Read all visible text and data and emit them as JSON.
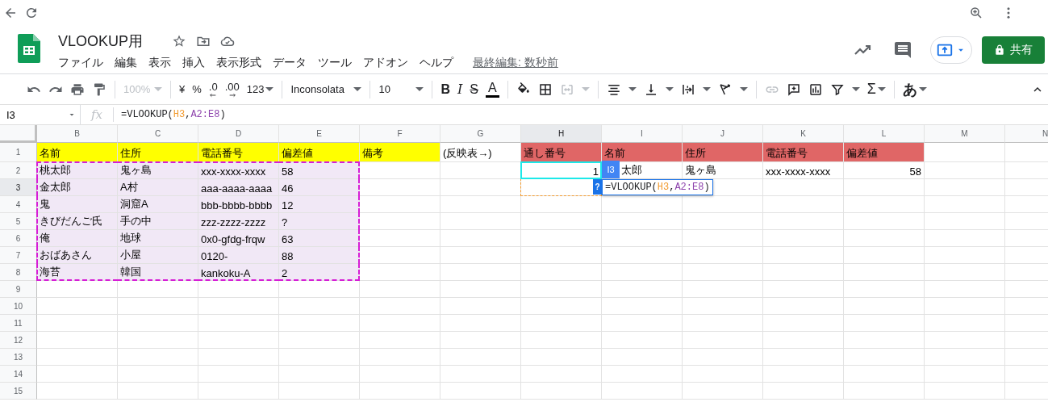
{
  "document": {
    "title": "VLOOKUP用",
    "menus": [
      "ファイル",
      "編集",
      "表示",
      "挿入",
      "表示形式",
      "データ",
      "ツール",
      "アドオン",
      "ヘルプ"
    ],
    "last_edit": "最終編集: 数秒前"
  },
  "share_button": {
    "label": "共有"
  },
  "toolbar": {
    "zoom": {
      "label": "100%",
      "disabled": true
    },
    "currency": "¥",
    "percent": "%",
    "decrease_decimals": ".0",
    "increase_decimals": ".00",
    "number_format": "123",
    "font": "Inconsolata",
    "font_size": "10",
    "bold": "B",
    "italic": "I",
    "strikethrough": "S",
    "text_color": "A",
    "functions": "Σ",
    "input_tools": "あ"
  },
  "formula_bar": {
    "name_box": "I3",
    "fx": "fx",
    "formula": [
      {
        "text": "=VLOOKUP("
      },
      {
        "text": "H3",
        "color": "#f29a2e"
      },
      {
        "text": ","
      },
      {
        "text": "A2:E8",
        "color": "#8e44ad"
      },
      {
        "text": ")"
      }
    ]
  },
  "grid": {
    "columns": [
      {
        "label": "B",
        "selected": false
      },
      {
        "label": "C",
        "selected": false
      },
      {
        "label": "D",
        "selected": false
      },
      {
        "label": "E",
        "selected": false
      },
      {
        "label": "F",
        "selected": false
      },
      {
        "label": "G",
        "selected": false
      },
      {
        "label": "H",
        "selected": true
      },
      {
        "label": "I",
        "selected": false
      },
      {
        "label": "J",
        "selected": false
      },
      {
        "label": "K",
        "selected": false
      },
      {
        "label": "L",
        "selected": false
      },
      {
        "label": "M",
        "selected": false
      },
      {
        "label": "N",
        "selected": false
      }
    ],
    "rows": [
      {
        "label": "1",
        "selected": false,
        "cells": [
          {
            "text": "名前",
            "kind": "text",
            "color": "#ffff00",
            "highlighted": false,
            "selected": false,
            "referenced": false
          },
          {
            "text": "住所",
            "kind": "text",
            "color": "#ffff00",
            "highlighted": false,
            "selected": false,
            "referenced": false
          },
          {
            "text": "電話番号",
            "kind": "text",
            "color": "#ffff00",
            "highlighted": false,
            "selected": false,
            "referenced": false
          },
          {
            "text": "偏差値",
            "kind": "text",
            "color": "#ffff00",
            "highlighted": false,
            "selected": false,
            "referenced": false
          },
          {
            "text": "備考",
            "kind": "text",
            "color": "#ffff00",
            "highlighted": false,
            "selected": false,
            "referenced": false
          },
          {
            "text": "(反映表→)",
            "kind": "text",
            "highlighted": false,
            "selected": false,
            "referenced": false
          },
          {
            "text": "通し番号",
            "kind": "text",
            "color": "#e06666",
            "highlighted": false,
            "selected": false,
            "referenced": false
          },
          {
            "text": "名前",
            "kind": "text",
            "color": "#e06666",
            "highlighted": false,
            "selected": false,
            "referenced": false
          },
          {
            "text": "住所",
            "kind": "text",
            "color": "#e06666",
            "highlighted": false,
            "selected": false,
            "referenced": false
          },
          {
            "text": "電話番号",
            "kind": "text",
            "color": "#e06666",
            "highlighted": false,
            "selected": false,
            "referenced": false
          },
          {
            "text": "偏差値",
            "kind": "text",
            "color": "#e06666",
            "highlighted": false,
            "selected": false,
            "referenced": false
          }
        ]
      },
      {
        "label": "2",
        "selected": false,
        "cells": [
          {
            "text": "桃太郎",
            "kind": "text",
            "highlighted": true,
            "selected": false,
            "referenced": false
          },
          {
            "text": "鬼ヶ島",
            "kind": "text",
            "highlighted": true,
            "selected": false,
            "referenced": false
          },
          {
            "text": "xxx-xxxx-xxxx",
            "kind": "text",
            "highlighted": true,
            "selected": false,
            "referenced": false
          },
          {
            "text": "58",
            "kind": "text",
            "highlighted": true,
            "selected": false,
            "referenced": false
          },
          null,
          null,
          {
            "text": "1",
            "kind": "number",
            "highlighted": false,
            "selected": true,
            "referenced": false
          },
          {
            "text": "太郎",
            "kind": "covered",
            "highlighted": false,
            "selected": false,
            "referenced": false
          },
          {
            "text": "鬼ヶ島",
            "kind": "text",
            "highlighted": false,
            "selected": false,
            "referenced": false
          },
          {
            "text": "xxx-xxxx-xxxx",
            "kind": "text",
            "highlighted": false,
            "selected": false,
            "referenced": false
          },
          {
            "text": "58",
            "kind": "number",
            "highlighted": false,
            "selected": false,
            "referenced": false
          }
        ]
      },
      {
        "label": "3",
        "selected": true,
        "cells": [
          {
            "text": "金太郎",
            "kind": "text",
            "highlighted": true,
            "selected": false,
            "referenced": false
          },
          {
            "text": "A村",
            "kind": "text",
            "highlighted": true,
            "selected": false,
            "referenced": false
          },
          {
            "text": "aaa-aaaa-aaaa",
            "kind": "text",
            "highlighted": true,
            "selected": false,
            "referenced": false
          },
          {
            "text": "46",
            "kind": "text",
            "highlighted": true,
            "selected": false,
            "referenced": false
          },
          null,
          null,
          {
            "kind": "text",
            "highlighted": false,
            "selected": false,
            "referenced": true
          },
          {
            "kind": "text",
            "highlighted": false,
            "selected": false,
            "referenced": false,
            "editor": {
              "reference_chip": "I3",
              "help_chip": "?",
              "formula": [
                {
                  "text": "=VLOOKUP("
                },
                {
                  "text": "H3",
                  "color": "#f29a2e"
                },
                {
                  "text": ","
                },
                {
                  "text": "A2:E8",
                  "color": "#8e44ad"
                },
                {
                  "text": ")"
                }
              ]
            }
          }
        ]
      },
      {
        "label": "4",
        "selected": false,
        "cells": [
          {
            "text": "鬼",
            "kind": "text",
            "highlighted": true,
            "selected": false,
            "referenced": false
          },
          {
            "text": "洞窟A",
            "kind": "text",
            "highlighted": true,
            "selected": false,
            "referenced": false
          },
          {
            "text": "bbb-bbbb-bbbb",
            "kind": "text",
            "highlighted": true,
            "selected": false,
            "referenced": false
          },
          {
            "text": "12",
            "kind": "text",
            "highlighted": true,
            "selected": false,
            "referenced": false
          }
        ]
      },
      {
        "label": "5",
        "selected": false,
        "cells": [
          {
            "text": "きびだんご氏",
            "kind": "text",
            "highlighted": true,
            "selected": false,
            "referenced": false
          },
          {
            "text": "手の中",
            "kind": "text",
            "highlighted": true,
            "selected": false,
            "referenced": false
          },
          {
            "text": "zzz-zzzz-zzzz",
            "kind": "text",
            "highlighted": true,
            "selected": false,
            "referenced": false
          },
          {
            "text": "?",
            "kind": "text",
            "highlighted": true,
            "selected": false,
            "referenced": false
          }
        ]
      },
      {
        "label": "6",
        "selected": false,
        "cells": [
          {
            "text": "俺",
            "kind": "text",
            "highlighted": true,
            "selected": false,
            "referenced": false
          },
          {
            "text": "地球",
            "kind": "text",
            "highlighted": true,
            "selected": false,
            "referenced": false
          },
          {
            "text": "0x0-gfdg-frqw",
            "kind": "text",
            "highlighted": true,
            "selected": false,
            "referenced": false
          },
          {
            "text": "63",
            "kind": "text",
            "highlighted": true,
            "selected": false,
            "referenced": false
          }
        ]
      },
      {
        "label": "7",
        "selected": false,
        "cells": [
          {
            "text": "おばあさん",
            "kind": "text",
            "highlighted": true,
            "selected": false,
            "referenced": false
          },
          {
            "text": "小屋",
            "kind": "text",
            "highlighted": true,
            "selected": false,
            "referenced": false
          },
          {
            "text": "0120-",
            "kind": "text",
            "highlighted": true,
            "selected": false,
            "referenced": false
          },
          {
            "text": "88",
            "kind": "text",
            "highlighted": true,
            "selected": false,
            "referenced": false
          }
        ]
      },
      {
        "label": "8",
        "selected": false,
        "cells": [
          {
            "text": "海苔",
            "kind": "text",
            "highlighted": true,
            "selected": false,
            "referenced": false
          },
          {
            "text": "韓国",
            "kind": "text",
            "highlighted": true,
            "selected": false,
            "referenced": false
          },
          {
            "text": "kankoku-A",
            "kind": "text",
            "highlighted": true,
            "selected": false,
            "referenced": false
          },
          {
            "text": "2",
            "kind": "text",
            "highlighted": true,
            "selected": false,
            "referenced": false
          }
        ]
      },
      {
        "label": "9",
        "selected": false
      },
      {
        "label": "10",
        "selected": false
      },
      {
        "label": "11",
        "selected": false
      },
      {
        "label": "12",
        "selected": false
      },
      {
        "label": "13",
        "selected": false
      },
      {
        "label": "14",
        "selected": false
      },
      {
        "label": "15",
        "selected": false
      }
    ]
  }
}
